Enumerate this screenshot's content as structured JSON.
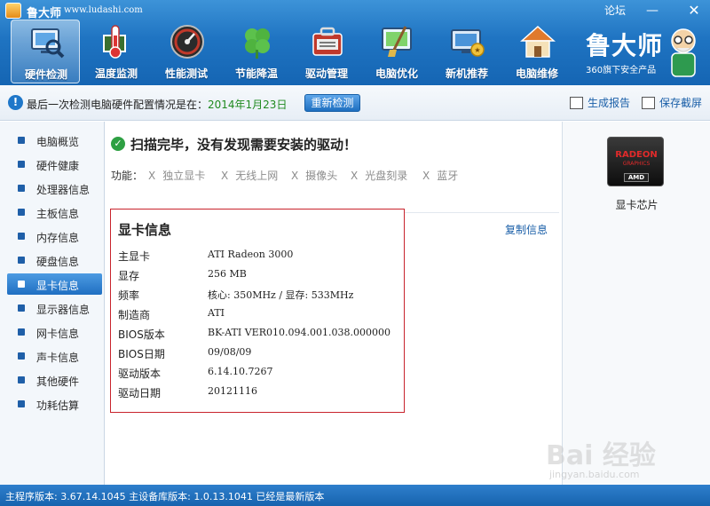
{
  "window": {
    "app_name": "鲁大师",
    "url": "www.ludashi.com",
    "forum_label": "论坛",
    "minimize_glyph": "—",
    "close_glyph": "✕"
  },
  "nav": {
    "items": [
      {
        "label": "硬件检测",
        "icon": "computer-magnifier-icon",
        "active": true
      },
      {
        "label": "温度监测",
        "icon": "thermometer-icon",
        "active": false
      },
      {
        "label": "性能测试",
        "icon": "speedometer-icon",
        "active": false
      },
      {
        "label": "节能降温",
        "icon": "clover-icon",
        "active": false
      },
      {
        "label": "驱动管理",
        "icon": "toolbox-icon",
        "active": false
      },
      {
        "label": "电脑优化",
        "icon": "broom-screen-icon",
        "active": false
      },
      {
        "label": "新机推荐",
        "icon": "monitor-badge-icon",
        "active": false
      },
      {
        "label": "电脑维修",
        "icon": "house-icon",
        "active": false
      }
    ]
  },
  "brand": {
    "name": "鲁大师",
    "subtitle": "360旗下安全产品"
  },
  "infobar": {
    "text": "最后一次检测电脑硬件配置情况是在：",
    "date": "2014年1月23日",
    "recheck_label": "重新检测",
    "report_label": "生成报告",
    "screenshot_label": "保存截屏"
  },
  "sidebar": {
    "items": [
      {
        "label": "电脑概览"
      },
      {
        "label": "硬件健康"
      },
      {
        "label": "处理器信息"
      },
      {
        "label": "主板信息"
      },
      {
        "label": "内存信息"
      },
      {
        "label": "硬盘信息"
      },
      {
        "label": "显卡信息"
      },
      {
        "label": "显示器信息"
      },
      {
        "label": "网卡信息"
      },
      {
        "label": "声卡信息"
      },
      {
        "label": "其他硬件"
      },
      {
        "label": "功耗估算"
      }
    ],
    "active_index": 6
  },
  "main": {
    "scan_title": "扫描完毕，没有发现需要安装的驱动！",
    "features_label": "功能：",
    "features": [
      {
        "x": "X",
        "label": "独立显卡"
      },
      {
        "x": "X",
        "label": "无线上网"
      },
      {
        "x": "X",
        "label": "摄像头"
      },
      {
        "x": "X",
        "label": "光盘刻录"
      },
      {
        "x": "X",
        "label": "蓝牙"
      }
    ],
    "copy_label": "复制信息",
    "gpu_title": "显卡信息",
    "gpu_rows": [
      {
        "key": "主显卡",
        "value": "ATI Radeon 3000"
      },
      {
        "key": "显存",
        "value": "256 MB"
      },
      {
        "key": "频率",
        "value": "核心: 350MHz / 显存: 533MHz"
      },
      {
        "key": "制造商",
        "value": "ATI"
      },
      {
        "key": "BIOS版本",
        "value": "BK-ATI VER010.094.001.038.000000"
      },
      {
        "key": "BIOS日期",
        "value": "09/08/09"
      },
      {
        "key": "驱动版本",
        "value": "6.14.10.7267"
      },
      {
        "key": "驱动日期",
        "value": "20121116"
      }
    ]
  },
  "right_panel": {
    "logo_line1": "RADEON",
    "logo_line2": "GRAPHICS",
    "logo_line3": "AMD",
    "chip_label": "显卡芯片"
  },
  "statusbar": {
    "text": "主程序版本: 3.67.14.1045  主设备库版本: 1.0.13.1041  已经是最新版本"
  },
  "watermark": {
    "text": "Bai 经验",
    "url": "jingyan.baidu.com"
  },
  "colors": {
    "header_blue": "#1f74c2",
    "gpu_box_border": "#c8232c",
    "date_green": "#1f8a1f",
    "link_blue": "#1a5fa8"
  }
}
